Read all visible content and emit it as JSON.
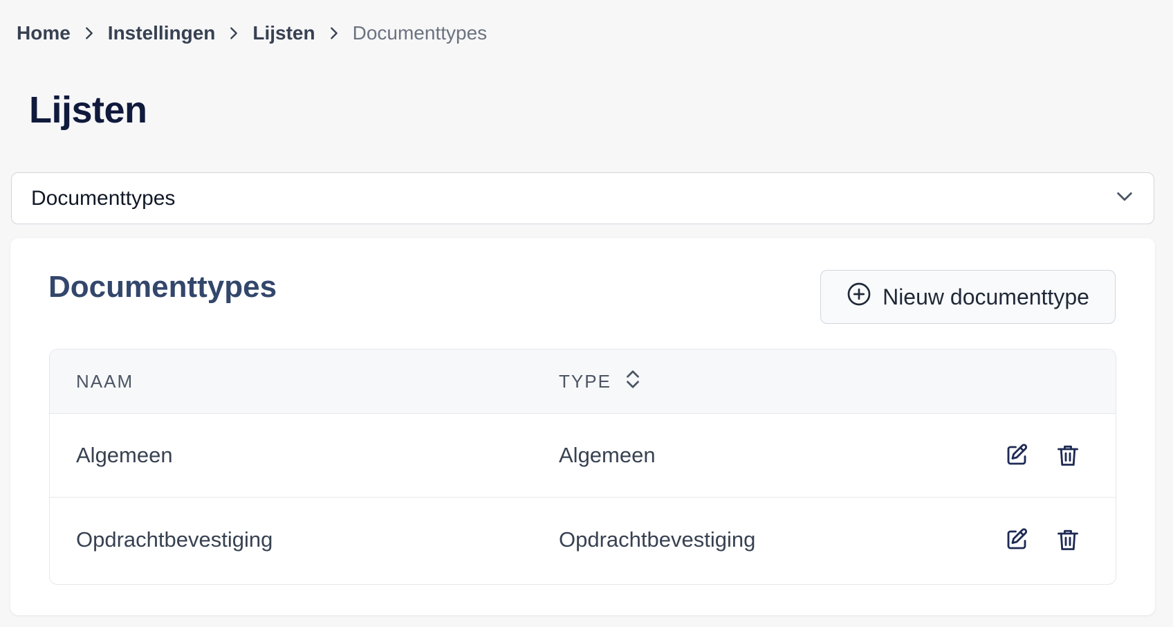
{
  "breadcrumb": {
    "items": [
      "Home",
      "Instellingen",
      "Lijsten"
    ],
    "current": "Documenttypes"
  },
  "page": {
    "title": "Lijsten"
  },
  "list_select": {
    "value": "Documenttypes"
  },
  "card": {
    "title": "Documenttypes",
    "new_button_label": "Nieuw documenttype"
  },
  "table": {
    "columns": {
      "naam": "NAAM",
      "type": "TYPE"
    },
    "rows": [
      {
        "naam": "Algemeen",
        "type": "Algemeen"
      },
      {
        "naam": "Opdrachtbevestiging",
        "type": "Opdrachtbevestiging"
      }
    ]
  },
  "icons": {
    "breadcrumb_separator": "chevron-right-icon",
    "select_toggle": "chevron-down-icon",
    "new_button": "plus-circle-icon",
    "sort": "sort-icon",
    "edit": "edit-icon",
    "delete": "trash-icon"
  },
  "colors": {
    "page_title": "#0f1a3c",
    "card_title": "#33466b",
    "action_icon": "#1e2a55"
  }
}
